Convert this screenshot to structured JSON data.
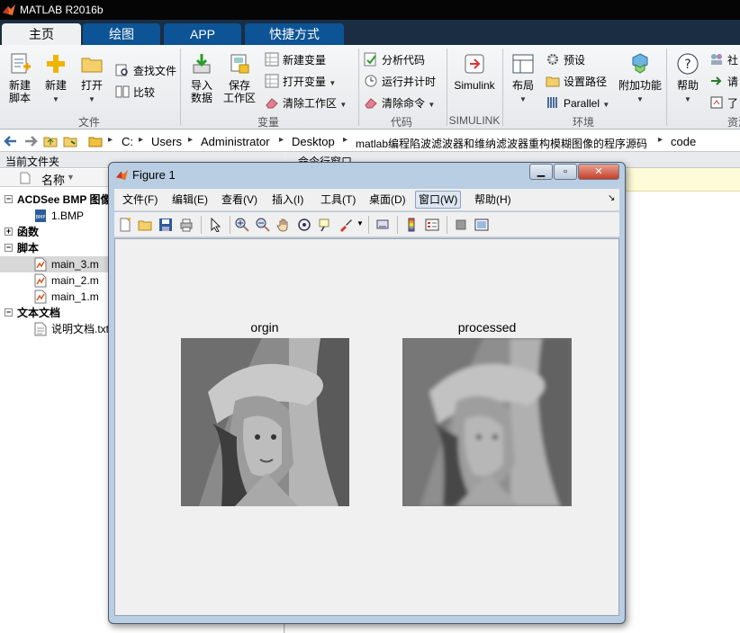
{
  "app": {
    "title": "MATLAB R2016b"
  },
  "tabs": [
    {
      "label": "主页"
    },
    {
      "label": "绘图"
    },
    {
      "label": "APP"
    },
    {
      "label": "快捷方式"
    }
  ],
  "ribbon": {
    "file": {
      "new_script": "新建\n脚本",
      "new": "新建",
      "open": "打开",
      "find_files": "查找文件",
      "compare": "比较",
      "group": "文件"
    },
    "variable": {
      "import": "导入\n数据",
      "save": "保存\n工作区",
      "new_var": "新建变量",
      "open_var": "打开变量",
      "clear_ws": "清除工作区",
      "group": "变量"
    },
    "code": {
      "analyze": "分析代码",
      "run_time": "运行并计时",
      "clear_cmd": "清除命令",
      "group": "代码"
    },
    "simulink": {
      "label": "Simulink",
      "group": "SIMULINK"
    },
    "env": {
      "layout": "布局",
      "prefs": "预设",
      "set_path": "设置路径",
      "parallel": "Parallel",
      "addons": "附加功能",
      "group": "环境"
    },
    "resources": {
      "help": "帮助",
      "community": "社",
      "request": "请",
      "learn": "了",
      "group": "资源"
    }
  },
  "address": {
    "crumbs": [
      "C:",
      "Users",
      "Administrator",
      "Desktop",
      "matlab编程陷波滤波器和维纳滤波器重构模糊图像的程序源码",
      "code"
    ]
  },
  "current_folder": {
    "title": "当前文件夹",
    "column_name": "名称",
    "groups": [
      {
        "label": "ACDSee BMP 图像",
        "items": [
          "1.BMP"
        ]
      },
      {
        "label": "函数",
        "items": []
      },
      {
        "label": "脚本",
        "items": [
          "main_3.m",
          "main_2.m",
          "main_1.m"
        ]
      },
      {
        "label": "文本文档",
        "items": [
          "说明文档.txt"
        ]
      }
    ],
    "selected": "main_3.m"
  },
  "command_window": {
    "title": "命令行窗口"
  },
  "figure": {
    "title": "Figure 1",
    "menu": [
      "文件(F)",
      "编辑(E)",
      "查看(V)",
      "插入(I)",
      "工具(T)",
      "桌面(D)",
      "窗口(W)",
      "帮助(H)"
    ],
    "hot_menu": "窗口(W)",
    "axes": [
      {
        "title": "orgin"
      },
      {
        "title": "processed"
      }
    ]
  },
  "colors": {
    "tabbar": "#1a2d42",
    "tab": "#0c5495",
    "figure_frame": "#b9cde3"
  }
}
